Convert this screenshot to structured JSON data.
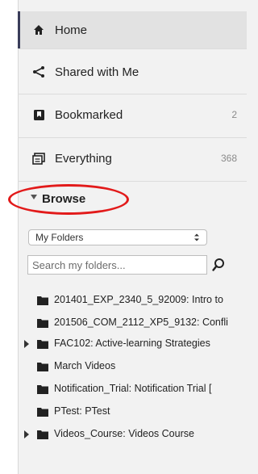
{
  "nav": {
    "home": {
      "label": "Home",
      "icon": "home-icon"
    },
    "shared": {
      "label": "Shared with Me",
      "icon": "share-icon"
    },
    "bookmarked": {
      "label": "Bookmarked",
      "count": "2",
      "icon": "bookmark-icon"
    },
    "everything": {
      "label": "Everything",
      "count": "368",
      "icon": "everything-icon"
    }
  },
  "browse": {
    "label": "Browse",
    "folder_select": {
      "selected": "My Folders"
    },
    "search": {
      "placeholder": "Search my folders..."
    }
  },
  "folders": [
    {
      "label": "201401_EXP_2340_5_92009: Intro to",
      "expandable": false,
      "icon": "folder-icon"
    },
    {
      "label": "201506_COM_2112_XP5_9132: Confli",
      "expandable": false,
      "icon": "folder-icon"
    },
    {
      "label": "FAC102: Active-learning Strategies",
      "expandable": true,
      "icon": "folder-icon"
    },
    {
      "label": "March Videos",
      "expandable": false,
      "icon": "folder-icon"
    },
    {
      "label": "Notification_Trial: Notification Trial [",
      "expandable": false,
      "icon": "folder-icon"
    },
    {
      "label": "PTest: PTest",
      "expandable": false,
      "icon": "folder-icon"
    },
    {
      "label": "Videos_Course: Videos Course",
      "expandable": true,
      "icon": "folder-icon"
    }
  ],
  "colors": {
    "annotation": "#e21a1a",
    "home_accent": "#3a3d5a",
    "count_text": "#8a8a8a"
  }
}
